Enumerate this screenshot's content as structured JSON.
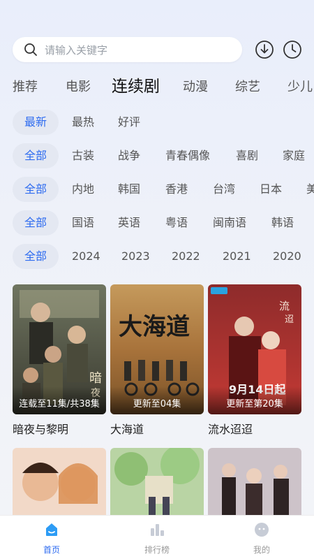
{
  "search": {
    "placeholder": "请输入关键字"
  },
  "header_icons": [
    "download-icon",
    "history-icon"
  ],
  "tabs": [
    "推荐",
    "电影",
    "连续剧",
    "动漫",
    "综艺",
    "少儿"
  ],
  "active_tab": "连续剧",
  "filters": {
    "sort": [
      "最新",
      "最热",
      "好评"
    ],
    "genre": [
      "全部",
      "古装",
      "战争",
      "青春偶像",
      "喜剧",
      "家庭"
    ],
    "region": [
      "全部",
      "内地",
      "韩国",
      "香港",
      "台湾",
      "日本",
      "美"
    ],
    "language": [
      "全部",
      "国语",
      "英语",
      "粤语",
      "闽南语",
      "韩语"
    ],
    "year": [
      "全部",
      "2024",
      "2023",
      "2022",
      "2021",
      "2020"
    ]
  },
  "cards": [
    {
      "title": "暗夜与黎明",
      "badge": "连载至11集/共38集"
    },
    {
      "title": "大海道",
      "badge": "更新至04集"
    },
    {
      "title": "流水迢迢",
      "badge": "更新至第20集"
    }
  ],
  "bottom_nav": [
    {
      "label": "首页",
      "icon": "home-icon"
    },
    {
      "label": "排行榜",
      "icon": "ranking-icon"
    },
    {
      "label": "我的",
      "icon": "profile-icon"
    }
  ],
  "colors": {
    "accent": "#2d6bf0",
    "chip_bg": "#e4e8f2"
  }
}
